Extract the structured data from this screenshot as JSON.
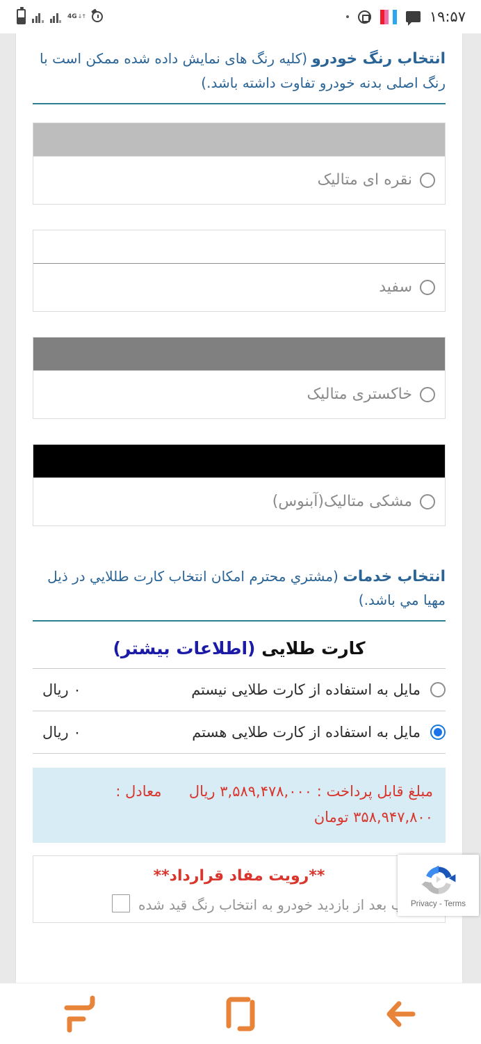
{
  "statusbar": {
    "time": "۱۹:۵۷",
    "network_label": "4G",
    "network_arrows": "↓↑"
  },
  "color_section": {
    "heading_lead": "انتخاب رنگ خودرو",
    "heading_note": " (کلیه رنگ های نمایش داده شده ممکن است با رنگ اصلی بدنه خودرو تفاوت داشته باشد.)",
    "options": [
      {
        "label": "نقره ای متالیک",
        "swatch": "#bdbdbd",
        "selected": false
      },
      {
        "label": "سفید",
        "swatch": "#ffffff",
        "selected": false
      },
      {
        "label": "خاکستری متالیک",
        "swatch": "#808080",
        "selected": false
      },
      {
        "label": "مشکی متالیک(آبنوس)",
        "swatch": "#000000",
        "selected": false
      }
    ]
  },
  "services_section": {
    "heading_lead": "انتخاب خدمات",
    "heading_note": " (مشتري محترم امکان انتخاب کارت طللايي در ذيل مهيا مي باشد.)",
    "card_title": "کارت طلایی ",
    "card_more_link": "(اطلاعات بیشتر)",
    "options": [
      {
        "label": "مایل به استفاده از کارت طلایی نیستم",
        "price": "۰ ریال",
        "selected": false
      },
      {
        "label": "مایل به استفاده از کارت طلایی هستم",
        "price": "۰ ریال",
        "selected": true
      }
    ]
  },
  "payment_banner": {
    "label": "مبلغ قابل پرداخت :",
    "amount_rial": "۳,۵۸۹,۴۷۸,۰۰۰ ریال",
    "equivalent_label": "معادل :",
    "amount_toman": "۳۵۸,۹۴۷,۸۰۰ تومان"
  },
  "contract": {
    "title": "**رویت مفاد قرارداد**",
    "text": "اینجانب بعد از بازدید خودرو به انتخاب رنگ قید شده"
  },
  "recaptcha": {
    "text": "Privacy - Terms"
  },
  "colors": {
    "heading_blue": "#2a6496",
    "rule_teal": "#2a7f8f",
    "radio_selected": "#1a73e8",
    "banner_bg": "#d7ecf5",
    "banner_text": "#d9352c",
    "nav_orange": "#e8833a"
  }
}
